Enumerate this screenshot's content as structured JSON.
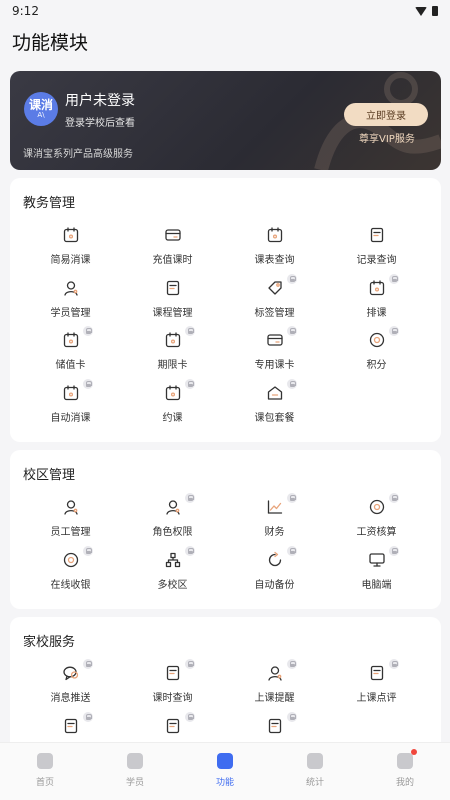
{
  "status": {
    "time": "9:12"
  },
  "page": {
    "title": "功能模块"
  },
  "vip": {
    "logo_main": "课消",
    "logo_sub": "A\\",
    "user": "用户未登录",
    "hint": "登录学校后查看",
    "desc": "课消宝系列产品高级服务",
    "login_label": "立即登录",
    "sub_label": "尊享VIP服务"
  },
  "sections": {
    "teaching": {
      "title": "教务管理",
      "items": [
        {
          "label": "简易消课",
          "icon": "calendar-grid-icon",
          "locked": false
        },
        {
          "label": "充值课时",
          "icon": "card-recharge-icon",
          "locked": false
        },
        {
          "label": "课表查询",
          "icon": "calendar-icon",
          "locked": false
        },
        {
          "label": "记录查询",
          "icon": "document-icon",
          "locked": false
        },
        {
          "label": "学员管理",
          "icon": "student-icon",
          "locked": false
        },
        {
          "label": "课程管理",
          "icon": "course-book-icon",
          "locked": false
        },
        {
          "label": "标签管理",
          "icon": "tag-icon",
          "locked": true
        },
        {
          "label": "排课",
          "icon": "schedule-icon",
          "locked": true
        },
        {
          "label": "储值卡",
          "icon": "stored-card-icon",
          "locked": true
        },
        {
          "label": "期限卡",
          "icon": "time-card-icon",
          "locked": true
        },
        {
          "label": "专用课卡",
          "icon": "special-card-icon",
          "locked": true
        },
        {
          "label": "积分",
          "icon": "points-icon",
          "locked": true
        },
        {
          "label": "自动消课",
          "icon": "auto-calendar-icon",
          "locked": true
        },
        {
          "label": "约课",
          "icon": "booking-icon",
          "locked": true
        },
        {
          "label": "课包套餐",
          "icon": "package-icon",
          "locked": true
        }
      ]
    },
    "campus": {
      "title": "校区管理",
      "items": [
        {
          "label": "员工管理",
          "icon": "staff-icon",
          "locked": false
        },
        {
          "label": "角色权限",
          "icon": "role-icon",
          "locked": true
        },
        {
          "label": "财务",
          "icon": "finance-chart-icon",
          "locked": true
        },
        {
          "label": "工资核算",
          "icon": "salary-icon",
          "locked": true
        },
        {
          "label": "在线收银",
          "icon": "cashier-icon",
          "locked": true
        },
        {
          "label": "多校区",
          "icon": "multi-campus-icon",
          "locked": true
        },
        {
          "label": "自动备份",
          "icon": "backup-icon",
          "locked": true
        },
        {
          "label": "电脑端",
          "icon": "computer-icon",
          "locked": true
        }
      ]
    },
    "home_school": {
      "title": "家校服务",
      "items": [
        {
          "label": "消息推送",
          "icon": "message-icon",
          "locked": true
        },
        {
          "label": "课时查询",
          "icon": "hours-query-icon",
          "locked": true
        },
        {
          "label": "上课提醒",
          "icon": "reminder-icon",
          "locked": true
        },
        {
          "label": "上课点评",
          "icon": "review-icon",
          "locked": true
        },
        {
          "label": "",
          "icon": "homework-icon",
          "locked": true
        },
        {
          "label": "",
          "icon": "rating-icon",
          "locked": true
        },
        {
          "label": "",
          "icon": "edit-icon",
          "locked": true
        }
      ]
    }
  },
  "tabs": [
    {
      "label": "首页",
      "icon": "home-icon",
      "active": false
    },
    {
      "label": "学员",
      "icon": "students-icon",
      "active": false
    },
    {
      "label": "功能",
      "icon": "grid-icon",
      "active": true
    },
    {
      "label": "统计",
      "icon": "stats-icon",
      "active": false
    },
    {
      "label": "我的",
      "icon": "profile-icon",
      "active": false,
      "badge": true
    }
  ],
  "colors": {
    "accent": "#3f6cf0",
    "banner": "#2b2b33",
    "gold": "#f2dcc3",
    "icon_accent": "#e8a47b"
  }
}
